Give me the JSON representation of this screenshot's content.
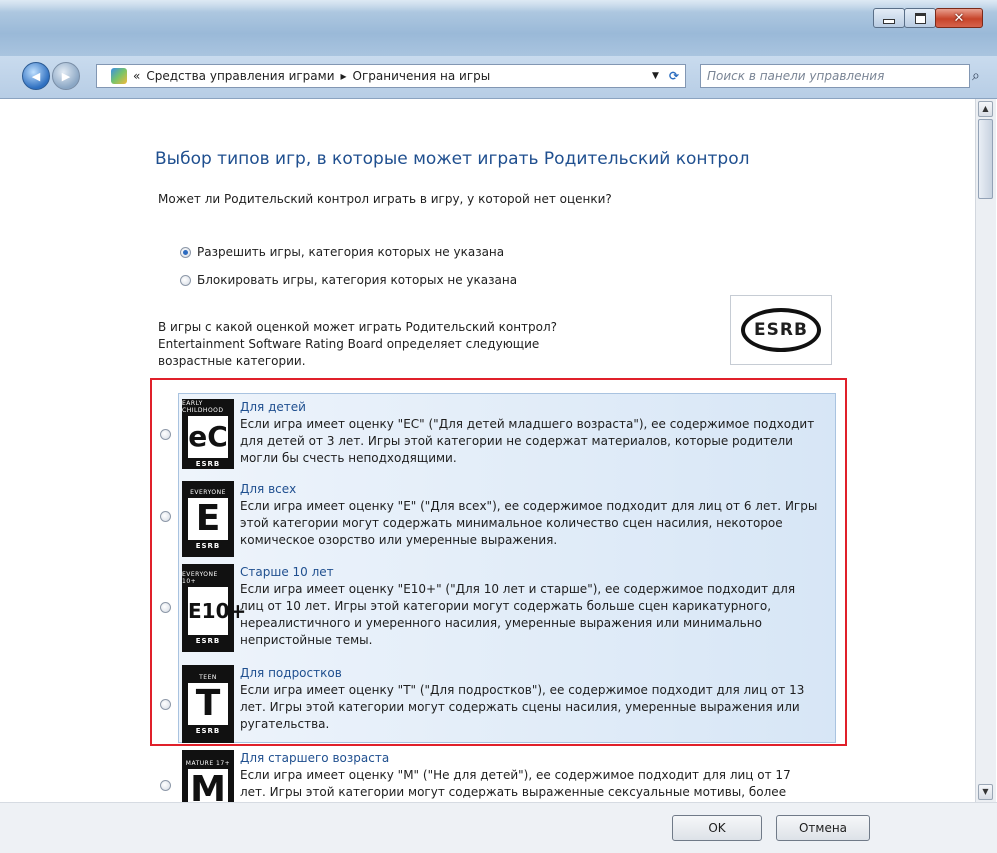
{
  "nav": {
    "back_glyph": "◀",
    "forward_glyph": "▶",
    "chevrons": "«",
    "crumbs": [
      "Средства управления играми",
      "Ограничения на игры"
    ],
    "crumb_sep": "▸",
    "search_placeholder": "Поиск в панели управления"
  },
  "page": {
    "heading": "Выбор типов игр, в которые может играть Родительский контрол",
    "question1": "Может ли Родительский контрол играть в игру, у которой нет оценки?",
    "unrated_options": [
      {
        "label": "Разрешить игры, категория которых не указана",
        "selected": true
      },
      {
        "label": "Блокировать игры, категория которых не указана",
        "selected": false
      }
    ],
    "question2": "В игры с какой оценкой может играть Родительский контрол? Entertainment Software Rating Board определяет следующие возрастные категории.",
    "esrb_logo_text": "ESRB"
  },
  "ratings": [
    {
      "code": "eC",
      "badge_top": "EARLY CHILDHOOD",
      "title": "Для детей",
      "desc": "Если игра имеет оценку \"EC\" (\"Для детей младшего возраста\"), ее содержимое подходит для детей от 3 лет.  Игры этой категории не содержат материалов, которые родители могли бы счесть неподходящими."
    },
    {
      "code": "E",
      "badge_top": "EVERYONE",
      "title": "Для всех",
      "desc": "Если игра имеет оценку \"E\" (\"Для всех\"), ее содержимое подходит для лиц от 6 лет. Игры этой категории могут содержать минимальное количество сцен насилия, некоторое комическое озорство или умеренные выражения."
    },
    {
      "code": "E10+",
      "badge_top": "EVERYONE 10+",
      "title": "Старше 10 лет",
      "desc": "Если игра имеет оценку \"E10+\" (\"Для 10 лет и старше\"), ее содержимое подходит для лиц от 10 лет. Игры этой категории могут содержать больше сцен карикатурного, нереалистичного и умеренного насилия, умеренные выражения или минимально непристойные темы."
    },
    {
      "code": "T",
      "badge_top": "TEEN",
      "title": "Для подростков",
      "desc": "Если игра имеет оценку \"T\" (\"Для подростков\"), ее содержимое подходит для лиц от 13 лет.  Игры этой категории могут содержать сцены насилия, умеренные выражения или ругательства."
    },
    {
      "code": "M",
      "badge_top": "MATURE 17+",
      "title": "Для старшего возраста",
      "desc": "Если игра имеет оценку \"M\" (\"Не для детей\"), ее содержимое подходит для лиц от 17 лет.  Игры этой категории могут содержать выраженные сексуальные мотивы, более"
    }
  ],
  "badge_bottom": "ESRB",
  "footer": {
    "ok": "OK",
    "cancel": "Отмена"
  }
}
